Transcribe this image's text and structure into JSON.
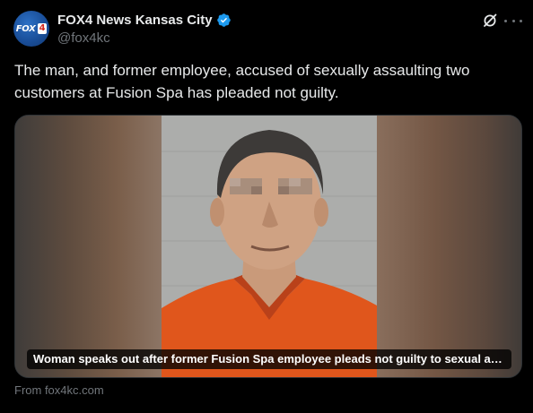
{
  "account": {
    "display_name": "FOX4 News Kansas City",
    "handle": "@fox4kc",
    "avatar_logo_text": "FOX",
    "avatar_logo_number": "4",
    "verified": true
  },
  "post": {
    "text": "The man, and former employee, accused of sexually assaulting two customers at Fusion Spa has pleaded not guilty."
  },
  "media": {
    "caption": "Woman speaks out after former Fusion Spa employee pleads not guilty to sexual assau…",
    "source": "From fox4kc.com"
  },
  "icons": {
    "verified": "verified-badge-icon",
    "grok": "grok-icon",
    "more": "more-options-icon"
  },
  "colors": {
    "background": "#000000",
    "text_primary": "#e7e9ea",
    "text_secondary": "#71767b",
    "verified_blue": "#1d9bf0",
    "jumpsuit_orange": "#e0561c"
  }
}
